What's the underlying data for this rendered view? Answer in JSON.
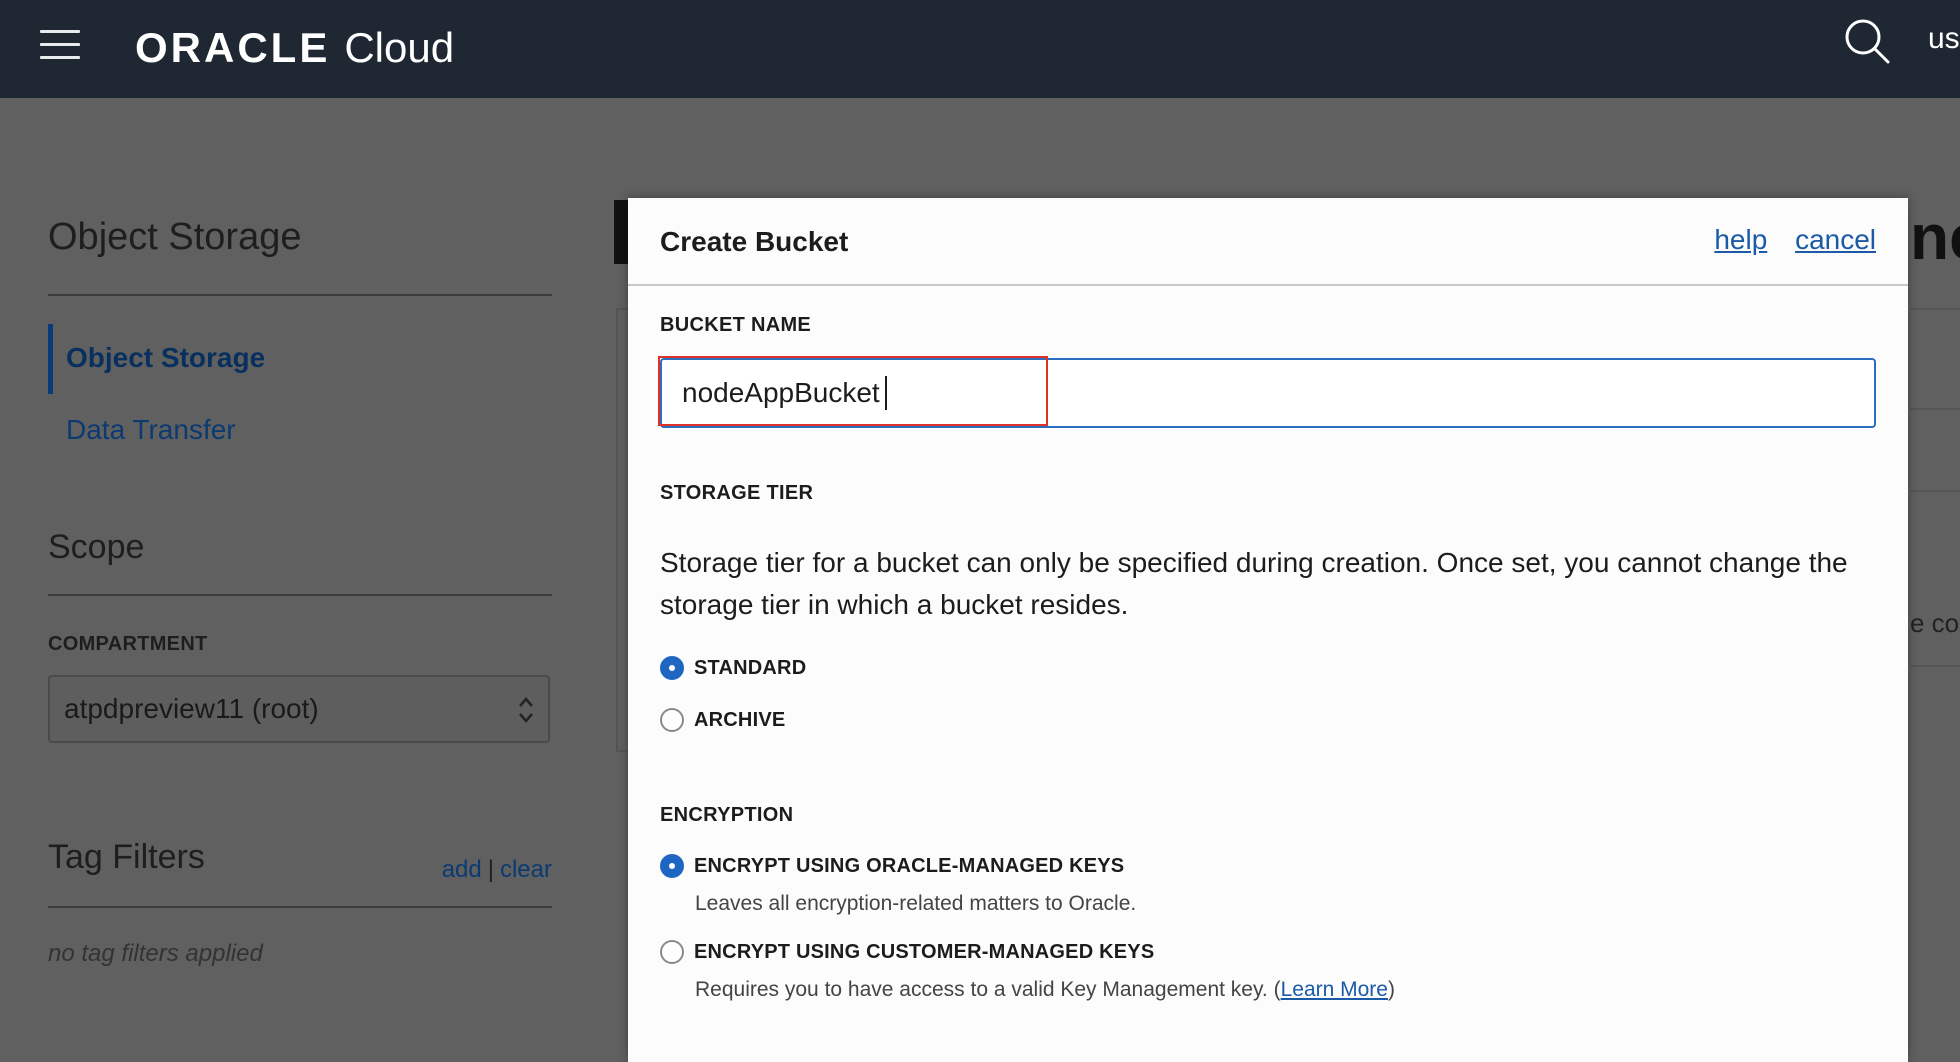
{
  "topbar": {
    "brand": "ORACLE",
    "product": "Cloud",
    "user_abbr": "us"
  },
  "sidebar": {
    "title": "Object Storage",
    "nav": [
      {
        "label": "Object Storage",
        "active": true
      },
      {
        "label": "Data Transfer",
        "active": false
      }
    ],
    "scope_title": "Scope",
    "compartment_label": "COMPARTMENT",
    "compartment_value": "atpdpreview11 (root)",
    "tag_filters_title": "Tag Filters",
    "tag_add": "add",
    "tag_sep": "|",
    "tag_clear": "clear",
    "no_tags": "no tag filters applied"
  },
  "background": {
    "title_fragment": "ne",
    "text_fragment": "e co"
  },
  "dialog": {
    "title": "Create Bucket",
    "help_link": "help",
    "cancel_link": "cancel",
    "bucket_name_label": "BUCKET NAME",
    "bucket_name_value": "nodeAppBucket",
    "storage_tier_label": "STORAGE TIER",
    "storage_tier_help": "Storage tier for a bucket can only be specified during creation. Once set, you cannot change the storage tier in which a bucket resides.",
    "storage_options": [
      {
        "label": "STANDARD",
        "checked": true
      },
      {
        "label": "ARCHIVE",
        "checked": false
      }
    ],
    "encryption_label": "ENCRYPTION",
    "encryption_options": [
      {
        "label": "ENCRYPT USING ORACLE-MANAGED KEYS",
        "checked": true,
        "desc": "Leaves all encryption-related matters to Oracle."
      },
      {
        "label": "ENCRYPT USING CUSTOMER-MANAGED KEYS",
        "checked": false,
        "desc_prefix": "Requires you to have access to a valid Key Management key. (",
        "desc_link": "Learn More",
        "desc_suffix": ")"
      }
    ]
  },
  "colors": {
    "topbar_bg": "#1f2733",
    "overlay_bg": "#606060",
    "link": "#1a5aa7",
    "radio_checked": "#1f66c2",
    "input_border": "#2a6ebd",
    "highlight": "#e0302a"
  }
}
